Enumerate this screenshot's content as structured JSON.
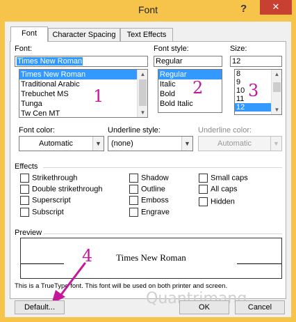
{
  "title": "Font",
  "title_buttons": {
    "help": "?",
    "close": "✕"
  },
  "tabs": [
    {
      "label": "Font",
      "active": true
    },
    {
      "label": "Character Spacing",
      "active": false
    },
    {
      "label": "Text Effects",
      "active": false
    }
  ],
  "font": {
    "label": "Font:",
    "value": "Times New Roman",
    "items": [
      "Times New Roman",
      "Traditional Arabic",
      "Trebuchet MS",
      "Tunga",
      "Tw Cen MT"
    ],
    "selected_index": 0
  },
  "font_style": {
    "label": "Font style:",
    "value": "Regular",
    "items": [
      "Regular",
      "Italic",
      "Bold",
      "Bold Italic"
    ],
    "selected_index": 0
  },
  "size": {
    "label": "Size:",
    "value": "12",
    "items": [
      "8",
      "9",
      "10",
      "11",
      "12"
    ],
    "selected_index": 4
  },
  "font_color": {
    "label": "Font color:",
    "value": "Automatic"
  },
  "underline_style": {
    "label": "Underline style:",
    "value": "(none)"
  },
  "underline_color": {
    "label": "Underline color:",
    "value": "Automatic",
    "enabled": false
  },
  "effects": {
    "label": "Effects",
    "checkboxes": [
      {
        "label": "Strikethrough",
        "checked": false
      },
      {
        "label": "Double strikethrough",
        "checked": false
      },
      {
        "label": "Superscript",
        "checked": false
      },
      {
        "label": "Subscript",
        "checked": false
      },
      {
        "label": "Shadow",
        "checked": false
      },
      {
        "label": "Outline",
        "checked": false
      },
      {
        "label": "Emboss",
        "checked": false
      },
      {
        "label": "Engrave",
        "checked": false
      },
      {
        "label": "Small caps",
        "checked": false
      },
      {
        "label": "All caps",
        "checked": false
      },
      {
        "label": "Hidden",
        "checked": false
      }
    ]
  },
  "preview": {
    "label": "Preview",
    "sample": "Times New Roman",
    "note": "This is a TrueType font. This font will be used on both printer and screen."
  },
  "buttons": {
    "default": "Default...",
    "ok": "OK",
    "cancel": "Cancel"
  },
  "annotations": {
    "n1": "1",
    "n2": "2",
    "n3": "3",
    "n4": "4",
    "arrow_color": "#c4179b"
  },
  "watermark": "Quantrimang"
}
